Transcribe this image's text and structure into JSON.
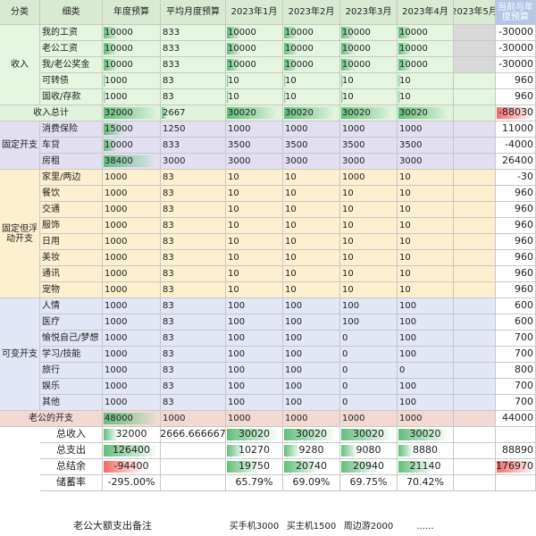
{
  "columns": [
    "分类",
    "细类",
    "年度预算",
    "平均月度预算",
    "2023年1月",
    "2023年2月",
    "2023年3月",
    "2023年4月",
    "2023年5月",
    "当前与年度预算"
  ],
  "groups": {
    "income": "收入",
    "fixed": "固定开支",
    "float": "固定但浮动开支",
    "var": "可变开支"
  },
  "income_rows": [
    {
      "name": "我的工资",
      "budget": "10000",
      "avg": "833",
      "jan": "10000",
      "feb": "10000",
      "mar": "10000",
      "apr": "10000",
      "may": "",
      "diff": "-30000"
    },
    {
      "name": "老公工资",
      "budget": "10000",
      "avg": "833",
      "jan": "10000",
      "feb": "10000",
      "mar": "10000",
      "apr": "10000",
      "may": "",
      "diff": "-30000"
    },
    {
      "name": "我/老公奖金",
      "budget": "10000",
      "avg": "833",
      "jan": "10000",
      "feb": "10000",
      "mar": "10000",
      "apr": "10000",
      "may": "",
      "diff": "-30000"
    },
    {
      "name": "可转债",
      "budget": "1000",
      "avg": "83",
      "jan": "10",
      "feb": "10",
      "mar": "10",
      "apr": "10",
      "may": "",
      "diff": "960"
    },
    {
      "name": "固收/存款",
      "budget": "1000",
      "avg": "83",
      "jan": "10",
      "feb": "10",
      "mar": "10",
      "apr": "10",
      "may": "",
      "diff": "960"
    }
  ],
  "income_total": {
    "name": "收入总计",
    "budget": "32000",
    "avg": "2667",
    "jan": "30020",
    "feb": "30020",
    "mar": "30020",
    "apr": "30020",
    "may": "",
    "diff": "-88030"
  },
  "fixed_rows": [
    {
      "name": "消费保险",
      "budget": "15000",
      "avg": "1250",
      "jan": "1000",
      "feb": "1000",
      "mar": "1000",
      "apr": "1000",
      "may": "",
      "diff": "11000"
    },
    {
      "name": "车贷",
      "budget": "10000",
      "avg": "833",
      "jan": "3500",
      "feb": "3500",
      "mar": "3500",
      "apr": "3500",
      "may": "",
      "diff": "-4000"
    },
    {
      "name": "房租",
      "budget": "38400",
      "avg": "3000",
      "jan": "3000",
      "feb": "3000",
      "mar": "3000",
      "apr": "3000",
      "may": "",
      "diff": "26400"
    }
  ],
  "float_rows": [
    {
      "name": "家里/两边",
      "budget": "1000",
      "avg": "83",
      "jan": "10",
      "feb": "10",
      "mar": "1000",
      "apr": "10",
      "may": "",
      "diff": "-30"
    },
    {
      "name": "餐饮",
      "budget": "1000",
      "avg": "83",
      "jan": "10",
      "feb": "10",
      "mar": "10",
      "apr": "10",
      "may": "",
      "diff": "960"
    },
    {
      "name": "交通",
      "budget": "1000",
      "avg": "83",
      "jan": "10",
      "feb": "10",
      "mar": "10",
      "apr": "10",
      "may": "",
      "diff": "960"
    },
    {
      "name": "服饰",
      "budget": "1000",
      "avg": "83",
      "jan": "10",
      "feb": "10",
      "mar": "10",
      "apr": "10",
      "may": "",
      "diff": "960"
    },
    {
      "name": "日用",
      "budget": "1000",
      "avg": "83",
      "jan": "10",
      "feb": "10",
      "mar": "10",
      "apr": "10",
      "may": "",
      "diff": "960"
    },
    {
      "name": "美妆",
      "budget": "1000",
      "avg": "83",
      "jan": "10",
      "feb": "10",
      "mar": "10",
      "apr": "10",
      "may": "",
      "diff": "960"
    },
    {
      "name": "通讯",
      "budget": "1000",
      "avg": "83",
      "jan": "10",
      "feb": "10",
      "mar": "10",
      "apr": "10",
      "may": "",
      "diff": "960"
    },
    {
      "name": "宠物",
      "budget": "1000",
      "avg": "83",
      "jan": "10",
      "feb": "10",
      "mar": "10",
      "apr": "10",
      "may": "",
      "diff": "960"
    }
  ],
  "var_rows": [
    {
      "name": "人情",
      "budget": "1000",
      "avg": "83",
      "jan": "100",
      "feb": "100",
      "mar": "100",
      "apr": "100",
      "may": "",
      "diff": "600"
    },
    {
      "name": "医疗",
      "budget": "1000",
      "avg": "83",
      "jan": "100",
      "feb": "100",
      "mar": "100",
      "apr": "100",
      "may": "",
      "diff": "600"
    },
    {
      "name": "愉悦自己/梦想",
      "budget": "1000",
      "avg": "83",
      "jan": "100",
      "feb": "100",
      "mar": "0",
      "apr": "100",
      "may": "",
      "diff": "700"
    },
    {
      "name": "学习/技能",
      "budget": "1000",
      "avg": "83",
      "jan": "100",
      "feb": "100",
      "mar": "0",
      "apr": "100",
      "may": "",
      "diff": "700"
    },
    {
      "name": "旅行",
      "budget": "1000",
      "avg": "83",
      "jan": "100",
      "feb": "100",
      "mar": "0",
      "apr": "0",
      "may": "",
      "diff": "800"
    },
    {
      "name": "娱乐",
      "budget": "1000",
      "avg": "83",
      "jan": "100",
      "feb": "100",
      "mar": "0",
      "apr": "100",
      "may": "",
      "diff": "700"
    },
    {
      "name": "其他",
      "budget": "1000",
      "avg": "83",
      "jan": "100",
      "feb": "100",
      "mar": "0",
      "apr": "100",
      "may": "",
      "diff": "700"
    }
  ],
  "lg_row": {
    "name": "老公的开支",
    "budget": "48000",
    "avg": "1000",
    "jan": "1000",
    "feb": "1000",
    "mar": "1000",
    "apr": "1000",
    "may": "",
    "diff": "44000"
  },
  "summary": {
    "total_income": {
      "label": "总收入",
      "budget": "32000",
      "avg": "2666.666667",
      "jan": "30020",
      "feb": "30020",
      "mar": "30020",
      "apr": "30020",
      "diff": ""
    },
    "total_spend": {
      "label": "总支出",
      "budget": "126400",
      "avg": "",
      "jan": "10270",
      "feb": "9280",
      "mar": "9080",
      "apr": "8880",
      "diff": "88890"
    },
    "balance": {
      "label": "总结余",
      "budget": "-94400",
      "avg": "",
      "jan": "19750",
      "feb": "20740",
      "mar": "20940",
      "apr": "21140",
      "diff": "-176970"
    },
    "savings": {
      "label": "储蓄率",
      "budget": "-295.00%",
      "avg": "",
      "jan": "65.79%",
      "feb": "69.09%",
      "mar": "69.75%",
      "apr": "70.42%",
      "diff": ""
    }
  },
  "notes": {
    "label": "老公大额支出备注",
    "jan": "买手机3000",
    "feb": "买主机1500",
    "mar": "周边游2000",
    "apr": "......"
  },
  "colors": {
    "green_bar": "#63be7b",
    "red_bar": "#f8696b",
    "header_blue": "#b4c7e7"
  }
}
